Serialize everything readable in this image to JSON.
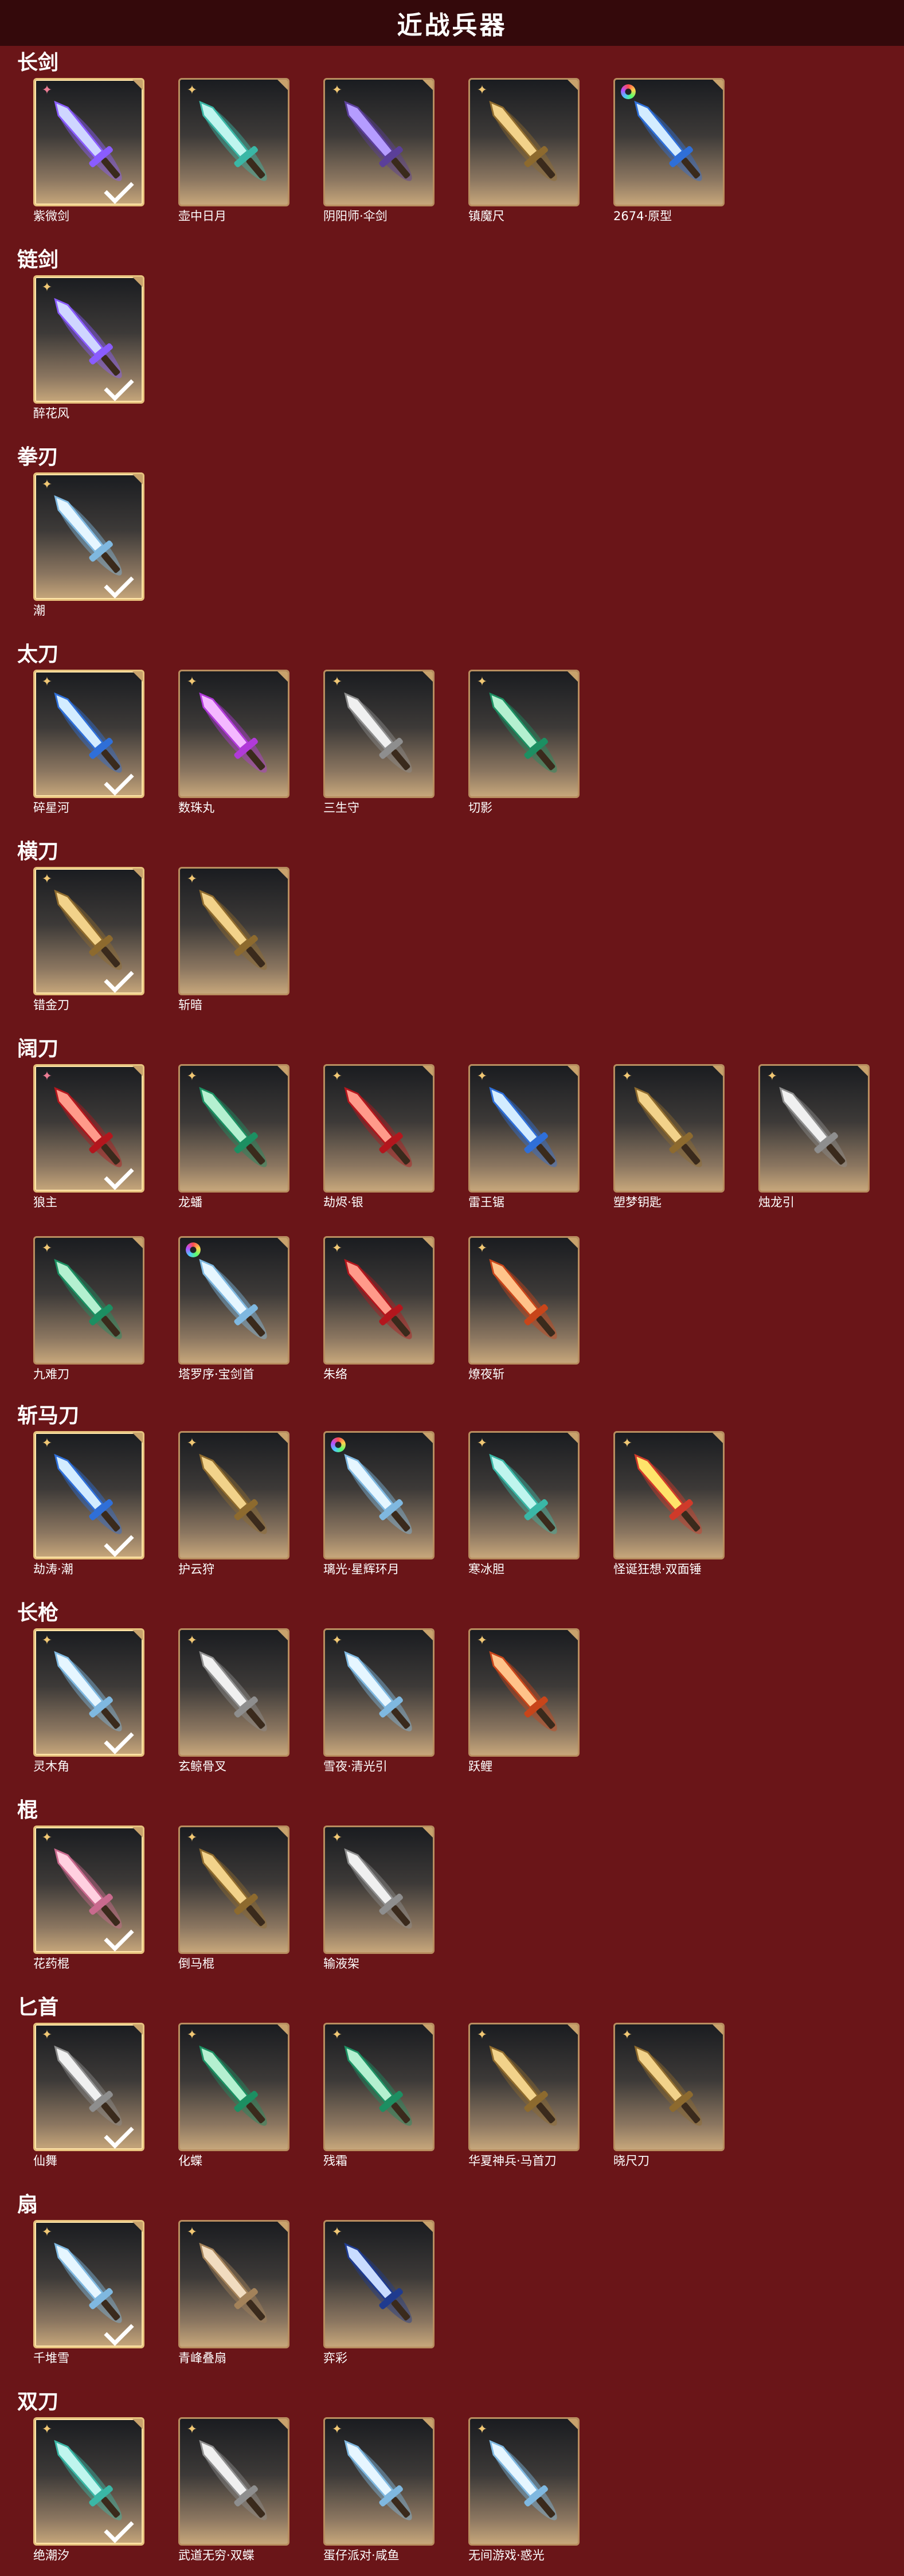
{
  "page": {
    "title": "近战兵器"
  },
  "colors": {
    "background": "#6a1518",
    "title_bar": "#34090b",
    "card_border": "#b88d5f",
    "owned_border": "#e6c17d"
  },
  "sections": [
    {
      "name": "长剑",
      "items": [
        {
          "name": "紫微剑",
          "rarity": "pink",
          "owned": true,
          "art": "violet"
        },
        {
          "name": "壶中日月",
          "rarity": "gold",
          "owned": false,
          "art": "cyan"
        },
        {
          "name": "阴阳师·伞剑",
          "rarity": "gold",
          "owned": false,
          "art": "purple"
        },
        {
          "name": "镇魔尺",
          "rarity": "gold",
          "owned": false,
          "art": "gold"
        },
        {
          "name": "2674·原型",
          "rarity": "rainbow",
          "owned": false,
          "art": "blue"
        }
      ]
    },
    {
      "name": "链剑",
      "items": [
        {
          "name": "醉花风",
          "rarity": "gold",
          "owned": true,
          "art": "violet"
        }
      ]
    },
    {
      "name": "拳刃",
      "items": [
        {
          "name": "潮",
          "rarity": "gold",
          "owned": true,
          "art": "ice"
        }
      ]
    },
    {
      "name": "太刀",
      "items": [
        {
          "name": "碎星河",
          "rarity": "gold",
          "owned": true,
          "art": "blue"
        },
        {
          "name": "数珠丸",
          "rarity": "gold",
          "owned": false,
          "art": "magenta"
        },
        {
          "name": "三生守",
          "rarity": "gold",
          "owned": false,
          "art": "silver"
        },
        {
          "name": "切影",
          "rarity": "gold",
          "owned": false,
          "art": "green"
        }
      ]
    },
    {
      "name": "横刀",
      "items": [
        {
          "name": "错金刀",
          "rarity": "gold",
          "owned": true,
          "art": "gold"
        },
        {
          "name": "斩暗",
          "rarity": "gold",
          "owned": false,
          "art": "gold"
        }
      ]
    },
    {
      "name": "阔刀",
      "items": [
        {
          "name": "狼主",
          "rarity": "pink",
          "owned": true,
          "art": "red"
        },
        {
          "name": "龙蟠",
          "rarity": "gold",
          "owned": false,
          "art": "green"
        },
        {
          "name": "劫烬·银",
          "rarity": "gold",
          "owned": false,
          "art": "red"
        },
        {
          "name": "雷王锯",
          "rarity": "gold",
          "owned": false,
          "art": "blue"
        },
        {
          "name": "塑梦钥匙",
          "rarity": "gold",
          "owned": false,
          "art": "gold"
        },
        {
          "name": "烛龙引",
          "rarity": "gold",
          "owned": false,
          "art": "silver"
        },
        {
          "name": "九难刀",
          "rarity": "gold",
          "owned": false,
          "art": "green"
        },
        {
          "name": "塔罗序·宝剑首",
          "rarity": "rainbow",
          "owned": false,
          "art": "ice"
        },
        {
          "name": "朱络",
          "rarity": "gold",
          "owned": false,
          "art": "red"
        },
        {
          "name": "燎夜斩",
          "rarity": "gold",
          "owned": false,
          "art": "orange"
        }
      ]
    },
    {
      "name": "斩马刀",
      "items": [
        {
          "name": "劫涛·潮",
          "rarity": "gold",
          "owned": true,
          "art": "blue"
        },
        {
          "name": "护云狩",
          "rarity": "gold",
          "owned": false,
          "art": "gold"
        },
        {
          "name": "璃光·星辉环月",
          "rarity": "rainbow",
          "owned": false,
          "art": "ice"
        },
        {
          "name": "寒冰胆",
          "rarity": "gold",
          "owned": false,
          "art": "cyan"
        },
        {
          "name": "怪诞狂想·双面锤",
          "rarity": "gold",
          "owned": false,
          "art": "yellow"
        }
      ]
    },
    {
      "name": "长枪",
      "items": [
        {
          "name": "灵木角",
          "rarity": "gold",
          "owned": true,
          "art": "ice"
        },
        {
          "name": "玄鲸骨叉",
          "rarity": "gold",
          "owned": false,
          "art": "silver"
        },
        {
          "name": "雪夜·清光引",
          "rarity": "gold",
          "owned": false,
          "art": "ice"
        },
        {
          "name": "跃鲤",
          "rarity": "gold",
          "owned": false,
          "art": "orange"
        }
      ]
    },
    {
      "name": "棍",
      "items": [
        {
          "name": "花药棍",
          "rarity": "gold",
          "owned": true,
          "art": "pink"
        },
        {
          "name": "倒马棍",
          "rarity": "gold",
          "owned": false,
          "art": "gold"
        },
        {
          "name": "输液架",
          "rarity": "gold",
          "owned": false,
          "art": "silver"
        }
      ]
    },
    {
      "name": "匕首",
      "items": [
        {
          "name": "仙舞",
          "rarity": "gold",
          "owned": true,
          "art": "silver"
        },
        {
          "name": "化蝶",
          "rarity": "gold",
          "owned": false,
          "art": "green"
        },
        {
          "name": "残霜",
          "rarity": "gold",
          "owned": false,
          "art": "green"
        },
        {
          "name": "华夏神兵·马首刀",
          "rarity": "gold",
          "owned": false,
          "art": "gold"
        },
        {
          "name": "晓尺刀",
          "rarity": "gold",
          "owned": false,
          "art": "gold"
        }
      ]
    },
    {
      "name": "扇",
      "items": [
        {
          "name": "千堆雪",
          "rarity": "gold",
          "owned": true,
          "art": "ice"
        },
        {
          "name": "青峰叠扇",
          "rarity": "gold",
          "owned": false,
          "art": "tan"
        },
        {
          "name": "弈彩",
          "rarity": "gold",
          "owned": false,
          "art": "navy"
        }
      ]
    },
    {
      "name": "双刀",
      "items": [
        {
          "name": "绝潮汐",
          "rarity": "gold",
          "owned": true,
          "art": "cyan"
        },
        {
          "name": "武道无穷·双蝶",
          "rarity": "gold",
          "owned": false,
          "art": "silver"
        },
        {
          "name": "蛋仔派对·咸鱼",
          "rarity": "gold",
          "owned": false,
          "art": "ice"
        },
        {
          "name": "无间游戏·惑光",
          "rarity": "gold",
          "owned": false,
          "art": "ice"
        }
      ]
    }
  ]
}
